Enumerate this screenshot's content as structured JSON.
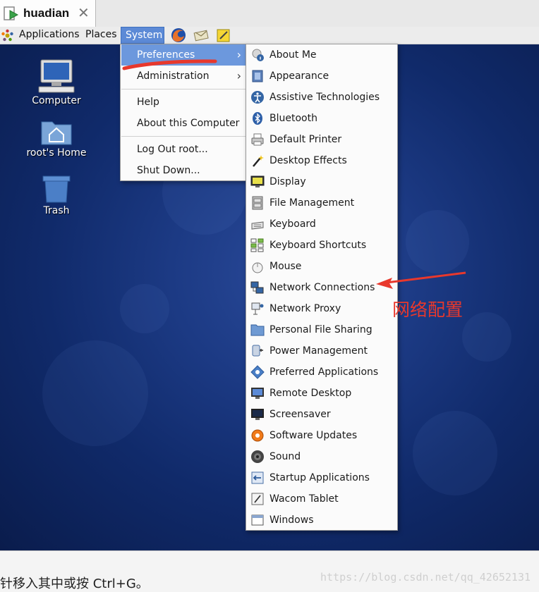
{
  "tab": {
    "title": "huadian",
    "close": "✕"
  },
  "panel": {
    "applications": "Applications",
    "places": "Places",
    "system": "System"
  },
  "desktop_icons": [
    {
      "label": "Computer"
    },
    {
      "label": "root's Home"
    },
    {
      "label": "Trash"
    }
  ],
  "system_menu": {
    "preferences": "Preferences",
    "administration": "Administration",
    "help": "Help",
    "about": "About this Computer",
    "logout": "Log Out root...",
    "shutdown": "Shut Down...",
    "arrow": "›"
  },
  "preferences_menu": [
    "About Me",
    "Appearance",
    "Assistive Technologies",
    "Bluetooth",
    "Default Printer",
    "Desktop Effects",
    "Display",
    "File Management",
    "Keyboard",
    "Keyboard Shortcuts",
    "Mouse",
    "Network Connections",
    "Network Proxy",
    "Personal File Sharing",
    "Power Management",
    "Preferred Applications",
    "Remote Desktop",
    "Screensaver",
    "Software Updates",
    "Sound",
    "Startup Applications",
    "Wacom Tablet",
    "Windows"
  ],
  "annotation": {
    "label": "网络配置"
  },
  "status": {
    "hint": "针移入其中或按 Ctrl+G。",
    "watermark": "https://blog.csdn.net/qq_42652131"
  },
  "colors": {
    "highlight": "#6c98dd",
    "annotation": "#e8382c",
    "desktop": "#1c3a84"
  }
}
